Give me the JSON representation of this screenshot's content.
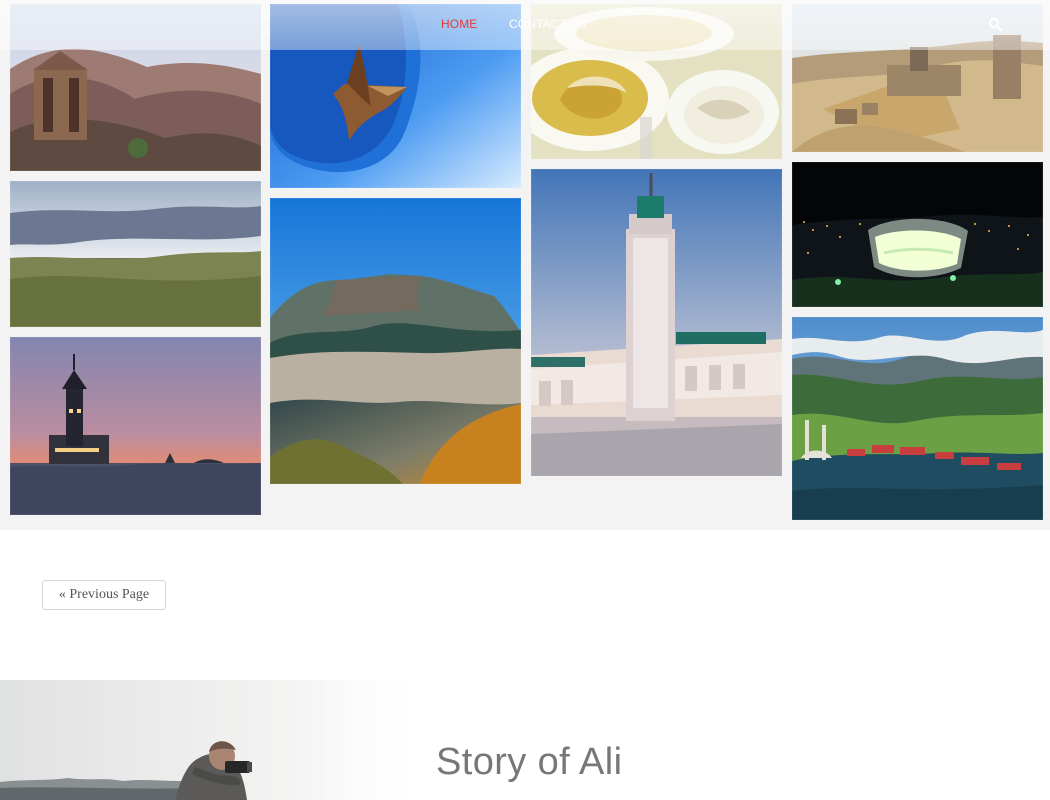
{
  "navigation": {
    "home_label": "HOME",
    "contact_label": "CONTACT US",
    "search_icon": "search-icon",
    "accent_color": "#e43b37"
  },
  "gallery": {
    "photos": [
      {
        "subject": "petra-monastery-photo"
      },
      {
        "subject": "savanna-plains-photo"
      },
      {
        "subject": "maiden-tower-photo"
      },
      {
        "subject": "blue-sculpture-photo"
      },
      {
        "subject": "table-mountain-photo"
      },
      {
        "subject": "plated-food-photo"
      },
      {
        "subject": "mosque-minaret-photo"
      },
      {
        "subject": "desert-ruins-photo"
      },
      {
        "subject": "night-stadium-photo"
      },
      {
        "subject": "mountain-lake-photo"
      }
    ]
  },
  "pagination": {
    "previous_label": "« Previous Page"
  },
  "story": {
    "title": "Story of Ali"
  }
}
